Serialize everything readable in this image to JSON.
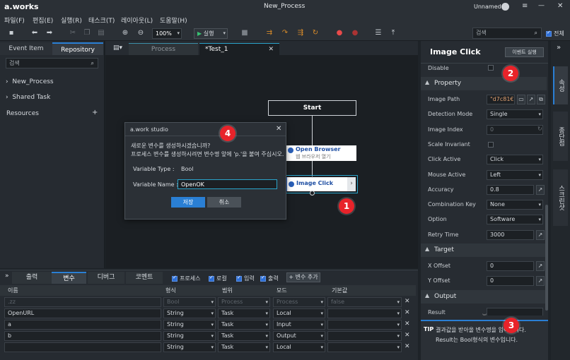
{
  "app": {
    "logo": "a.works",
    "title": "New_Process",
    "user": "Unnamed"
  },
  "window_controls": {
    "menu": "≡",
    "minimize": "—",
    "maximize": "☐",
    "close": "✕"
  },
  "menu": [
    "파일(F)",
    "편집(E)",
    "실행(R)",
    "태스크(T)",
    "레이아웃(L)",
    "도움말(H)"
  ],
  "toolbar": {
    "zoom": "100%",
    "run": "실행",
    "search_placeholder": "검색",
    "all_label": "전체"
  },
  "left": {
    "tabs": [
      "Event Item",
      "Repository"
    ],
    "search_placeholder": "검색",
    "tree": [
      "New_Process",
      "Shared Task"
    ],
    "resources": "Resources",
    "add": "+"
  },
  "editor": {
    "tabs": [
      "Process",
      "*Test_1"
    ],
    "close": "✕",
    "nodes": {
      "start": "Start",
      "browser_title": "Open Browser",
      "browser_sub": "웹 브라우저 열기",
      "image_click": "Image Click",
      "chevron": "›"
    }
  },
  "dialog": {
    "title": "a.work studio",
    "close": "✕",
    "message1": "새로운 변수를 생성하시겠습니까?",
    "message2": "프로세스 변수를 생성하시려면 변수명 앞에 'p.'을 붙여 주십시오.",
    "type_label": "Variable Type :",
    "type_value": "Bool",
    "name_label": "Variable Name :",
    "name_value": "OpenOK",
    "save": "저장",
    "cancel": "취소"
  },
  "bottom": {
    "tabs": [
      "출력",
      "변수",
      "디버그",
      "코멘트"
    ],
    "filters": [
      "프로세스",
      "로컬",
      "입력",
      "출력"
    ],
    "add_var": "+ 변수 추가",
    "headers": [
      "이름",
      "형식",
      "범위",
      "모드",
      "기본값"
    ],
    "rows": [
      {
        "name": ".zz",
        "type": "Bool",
        "scope": "Process",
        "mode": "Process",
        "default": "false",
        "dim": true
      },
      {
        "name": "OpenURL",
        "type": "String",
        "scope": "Task",
        "mode": "Local",
        "default": "",
        "dim": false
      },
      {
        "name": "a",
        "type": "String",
        "scope": "Task",
        "mode": "Input",
        "default": "",
        "dim": false
      },
      {
        "name": "b",
        "type": "String",
        "scope": "Task",
        "mode": "Output",
        "default": "",
        "dim": false
      },
      {
        "name": "",
        "type": "String",
        "scope": "Task",
        "mode": "Local",
        "default": "",
        "dim": false
      }
    ],
    "delete": "✕"
  },
  "right": {
    "title": "Image Click",
    "event_button": "이벤트 실행",
    "disable_label": "Disable",
    "sections": {
      "property": "Property",
      "target": "Target",
      "output": "Output"
    },
    "props": [
      {
        "label": "Image Path",
        "value": "\"d7c81€",
        "kind": "path"
      },
      {
        "label": "Detection Mode",
        "value": "Single",
        "kind": "select"
      },
      {
        "label": "Image Index",
        "value": "0",
        "kind": "dim"
      },
      {
        "label": "Scale Invariant",
        "value": "",
        "kind": "check"
      },
      {
        "label": "Click Active",
        "value": "Click",
        "kind": "select"
      },
      {
        "label": "Mouse Active",
        "value": "Left",
        "kind": "select"
      },
      {
        "label": "Accuracy",
        "value": "0.8",
        "kind": "text"
      },
      {
        "label": "Combination Key",
        "value": "None",
        "kind": "select"
      },
      {
        "label": "Option",
        "value": "Software",
        "kind": "select"
      },
      {
        "label": "Retry Time",
        "value": "3000",
        "kind": "link"
      }
    ],
    "target": [
      {
        "label": "X Offset",
        "value": "0"
      },
      {
        "label": "Y Offset",
        "value": "0"
      }
    ],
    "result_label": "Result",
    "tip_label": "TIP",
    "tip_line1": "결과값을 받아올 변수명을 입력합니다.",
    "tip_line2": "Result는 Bool형식의 변수입니다."
  },
  "strip": {
    "collapse": "»",
    "tabs": [
      "속성",
      "종단점",
      "스크린샷"
    ]
  },
  "badges": [
    "1",
    "2",
    "3",
    "4"
  ],
  "colors": {
    "accent": "#2a7fd4",
    "badge": "#e8232a",
    "node_border": "#2aa3c9"
  }
}
